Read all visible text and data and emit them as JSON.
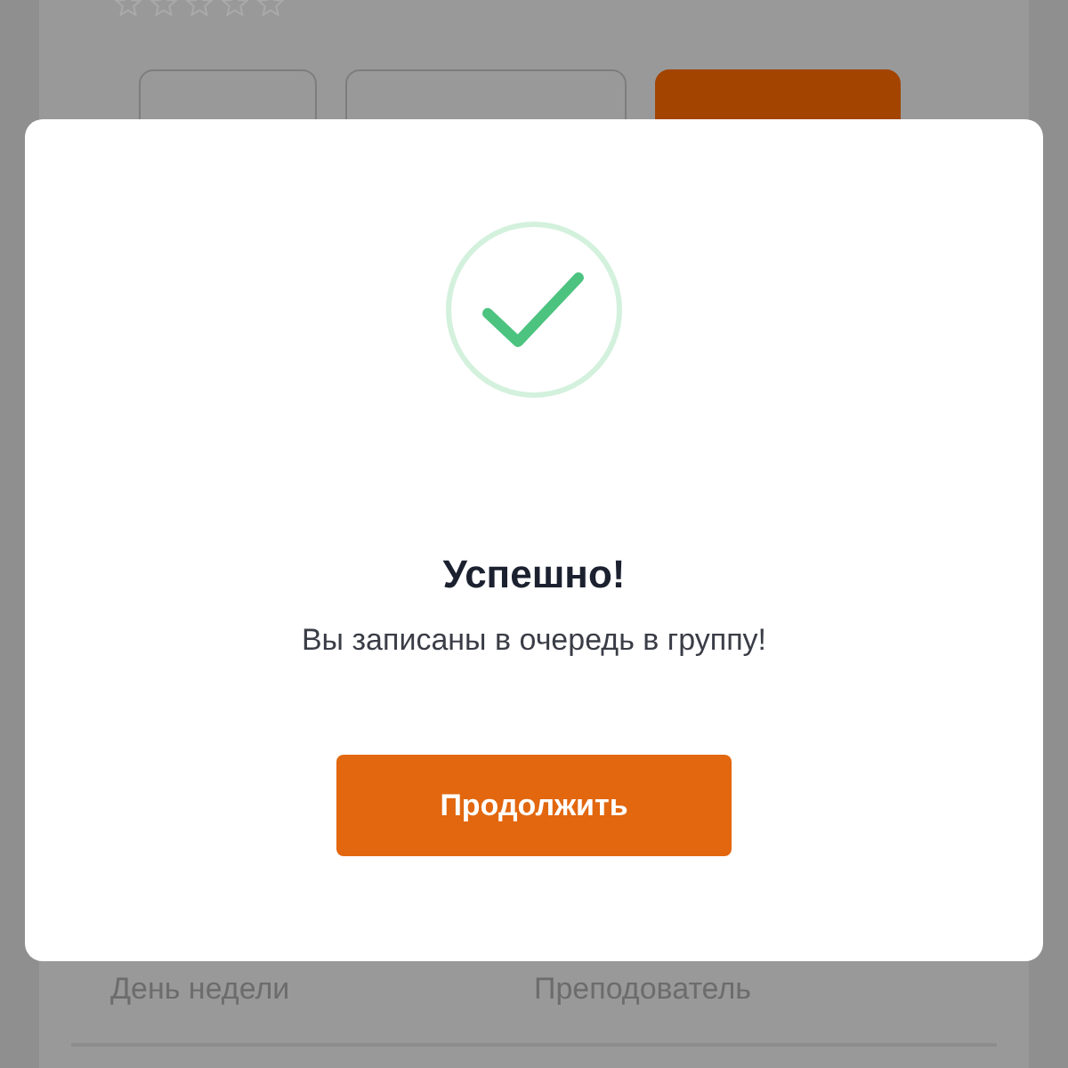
{
  "background": {
    "tabs": [
      {
        "selected": false
      },
      {
        "selected": false
      },
      {
        "selected": true
      }
    ],
    "table": {
      "columns": [
        "День недели",
        "Преподователь"
      ]
    }
  },
  "modal": {
    "title": "Успешно!",
    "message": "Вы записаны в очередь в группу!",
    "button": "Продолжить"
  }
}
